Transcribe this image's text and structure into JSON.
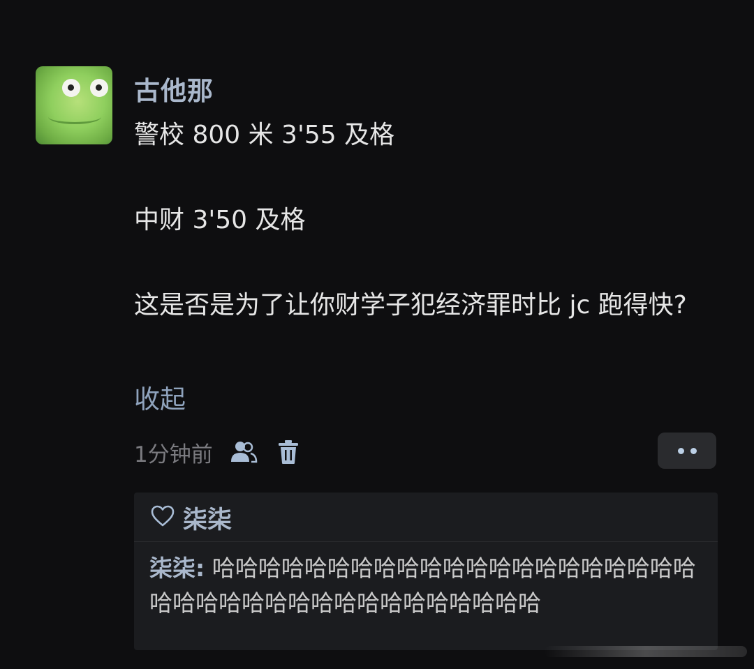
{
  "comment": {
    "username": "古他那",
    "lines": [
      "警校 800 米 3'55 及格",
      "中财 3'50 及格",
      "这是否是为了让你财学子犯经济罪时比 jc 跑得快?"
    ],
    "collapse_label": "收起",
    "time": "1分钟前"
  },
  "icons": {
    "follow": "users-icon",
    "delete": "trash-icon",
    "more": "more-dots-icon",
    "like": "heart-outline-icon"
  },
  "reply_box": {
    "liked_by": "柒柒",
    "reply_name": "柒柒:",
    "reply_text": "哈哈哈哈哈哈哈哈哈哈哈哈哈哈哈哈哈哈哈哈哈哈哈哈哈哈哈哈哈哈哈哈哈哈哈哈哈哈"
  },
  "colors": {
    "background": "#0e0e10",
    "username": "#aab8cc",
    "link": "#8fa3bd",
    "reply_box": "#1b1c1f"
  }
}
